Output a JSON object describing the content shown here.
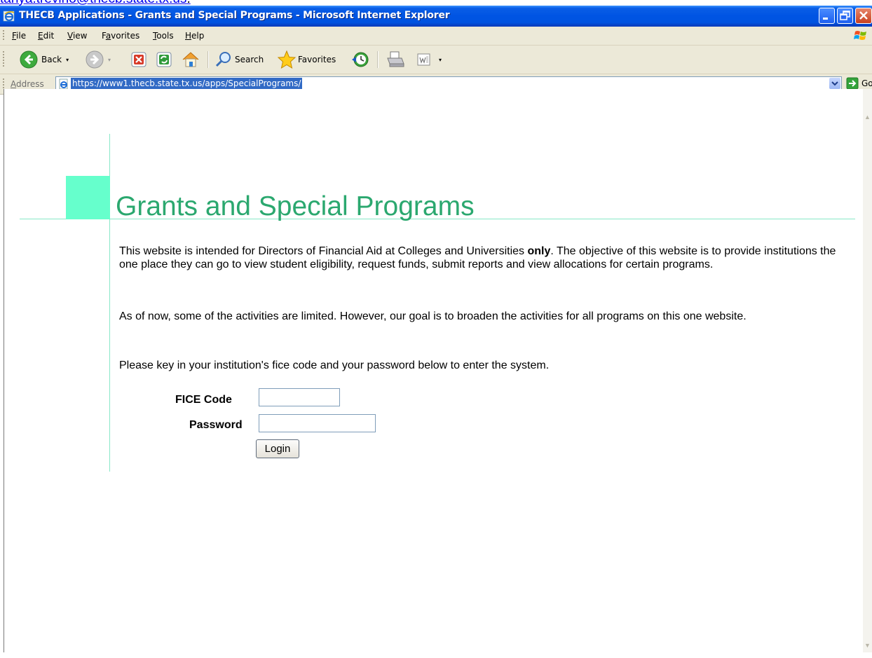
{
  "clipped_text": {
    "email": "tanya.trevino@thecb.state.tx.us",
    "suffix": "."
  },
  "window": {
    "title": "THECB Applications - Grants and Special Programs - Microsoft Internet Explorer"
  },
  "menu": {
    "items": [
      {
        "label": "File",
        "key": "F",
        "rest": "ile"
      },
      {
        "label": "Edit",
        "key": "E",
        "rest": "dit"
      },
      {
        "label": "View",
        "key": "V",
        "rest": "iew"
      },
      {
        "label": "Favorites",
        "key": "a",
        "pre": "F",
        "rest": "vorites"
      },
      {
        "label": "Tools",
        "key": "T",
        "rest": "ools"
      },
      {
        "label": "Help",
        "key": "H",
        "rest": "elp"
      }
    ]
  },
  "toolbar": {
    "back_label": "Back",
    "search_label": "Search",
    "favorites_label": "Favorites"
  },
  "address": {
    "label": "Address",
    "url": "https://www1.thecb.state.tx.us/apps/SpecialPrograms/",
    "go_label": "Go"
  },
  "page": {
    "heading": "Grants and Special Programs",
    "para1_before": "This website is intended for Directors of Financial Aid at Colleges and Universities ",
    "para1_bold": "only",
    "para1_after": ". The objective of this website is to provide institutions the one place they can go to view student eligibility, request funds, submit reports and view allocations for certain programs.",
    "para2": "As of now, some of the activities are limited. However, our goal is to broaden the activities for all programs on this one website.",
    "para3": "Please key in your institution's fice code and your password below to enter the system.",
    "fice_label": "FICE Code",
    "password_label": "Password",
    "fice_value": "",
    "password_value": "",
    "login_label": "Login"
  },
  "colors": {
    "heading": "#2ba86f",
    "accent_square": "#66ffcc",
    "rule_lines": "#88e8c8",
    "titlebar": "#0054e3"
  }
}
